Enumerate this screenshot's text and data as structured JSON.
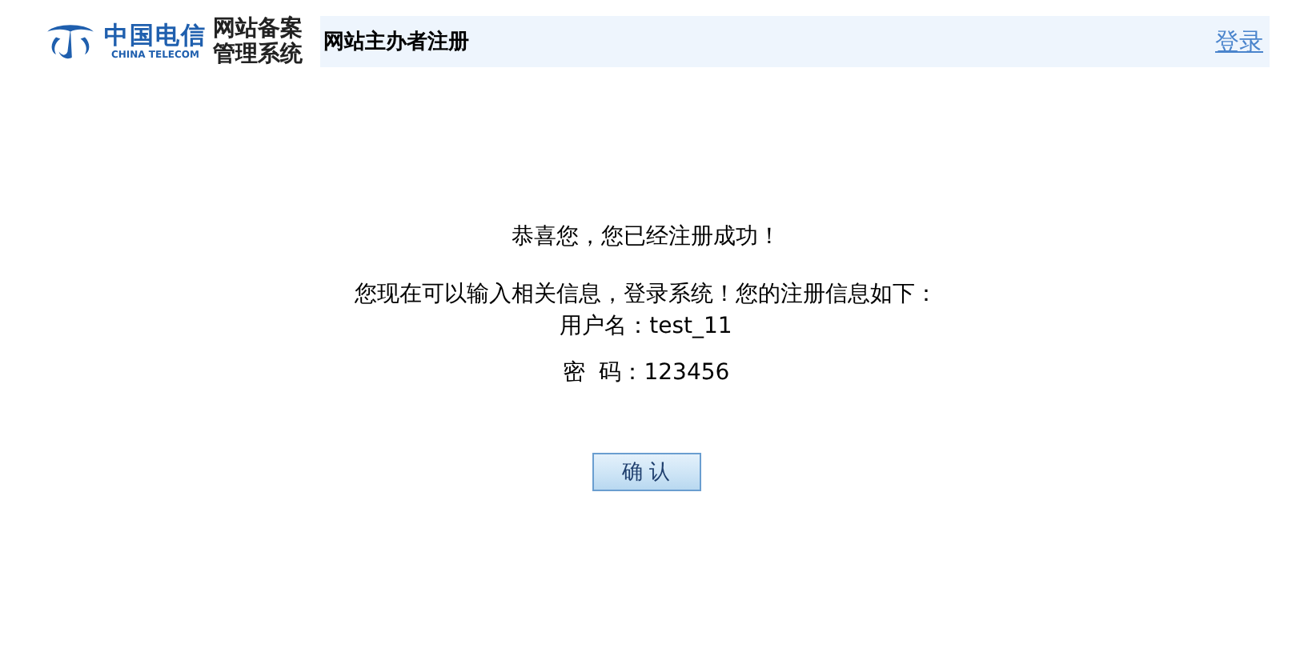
{
  "logo": {
    "name": "中国电信",
    "name_en": "CHINA TELECOM"
  },
  "system_name": [
    "网站备案",
    "管理系统"
  ],
  "header": {
    "title": "网站主办者注册",
    "login_link": "登录"
  },
  "message": {
    "lines": [
      "恭喜您，您已经注册成功！",
      "您现在可以输入相关信息，登录系统！您的注册信息如下："
    ],
    "fields": [
      {
        "label": "用户名：",
        "value": "test_11"
      },
      {
        "label": "密  码：",
        "value": "123456"
      }
    ]
  },
  "confirm_button": "确 认"
}
